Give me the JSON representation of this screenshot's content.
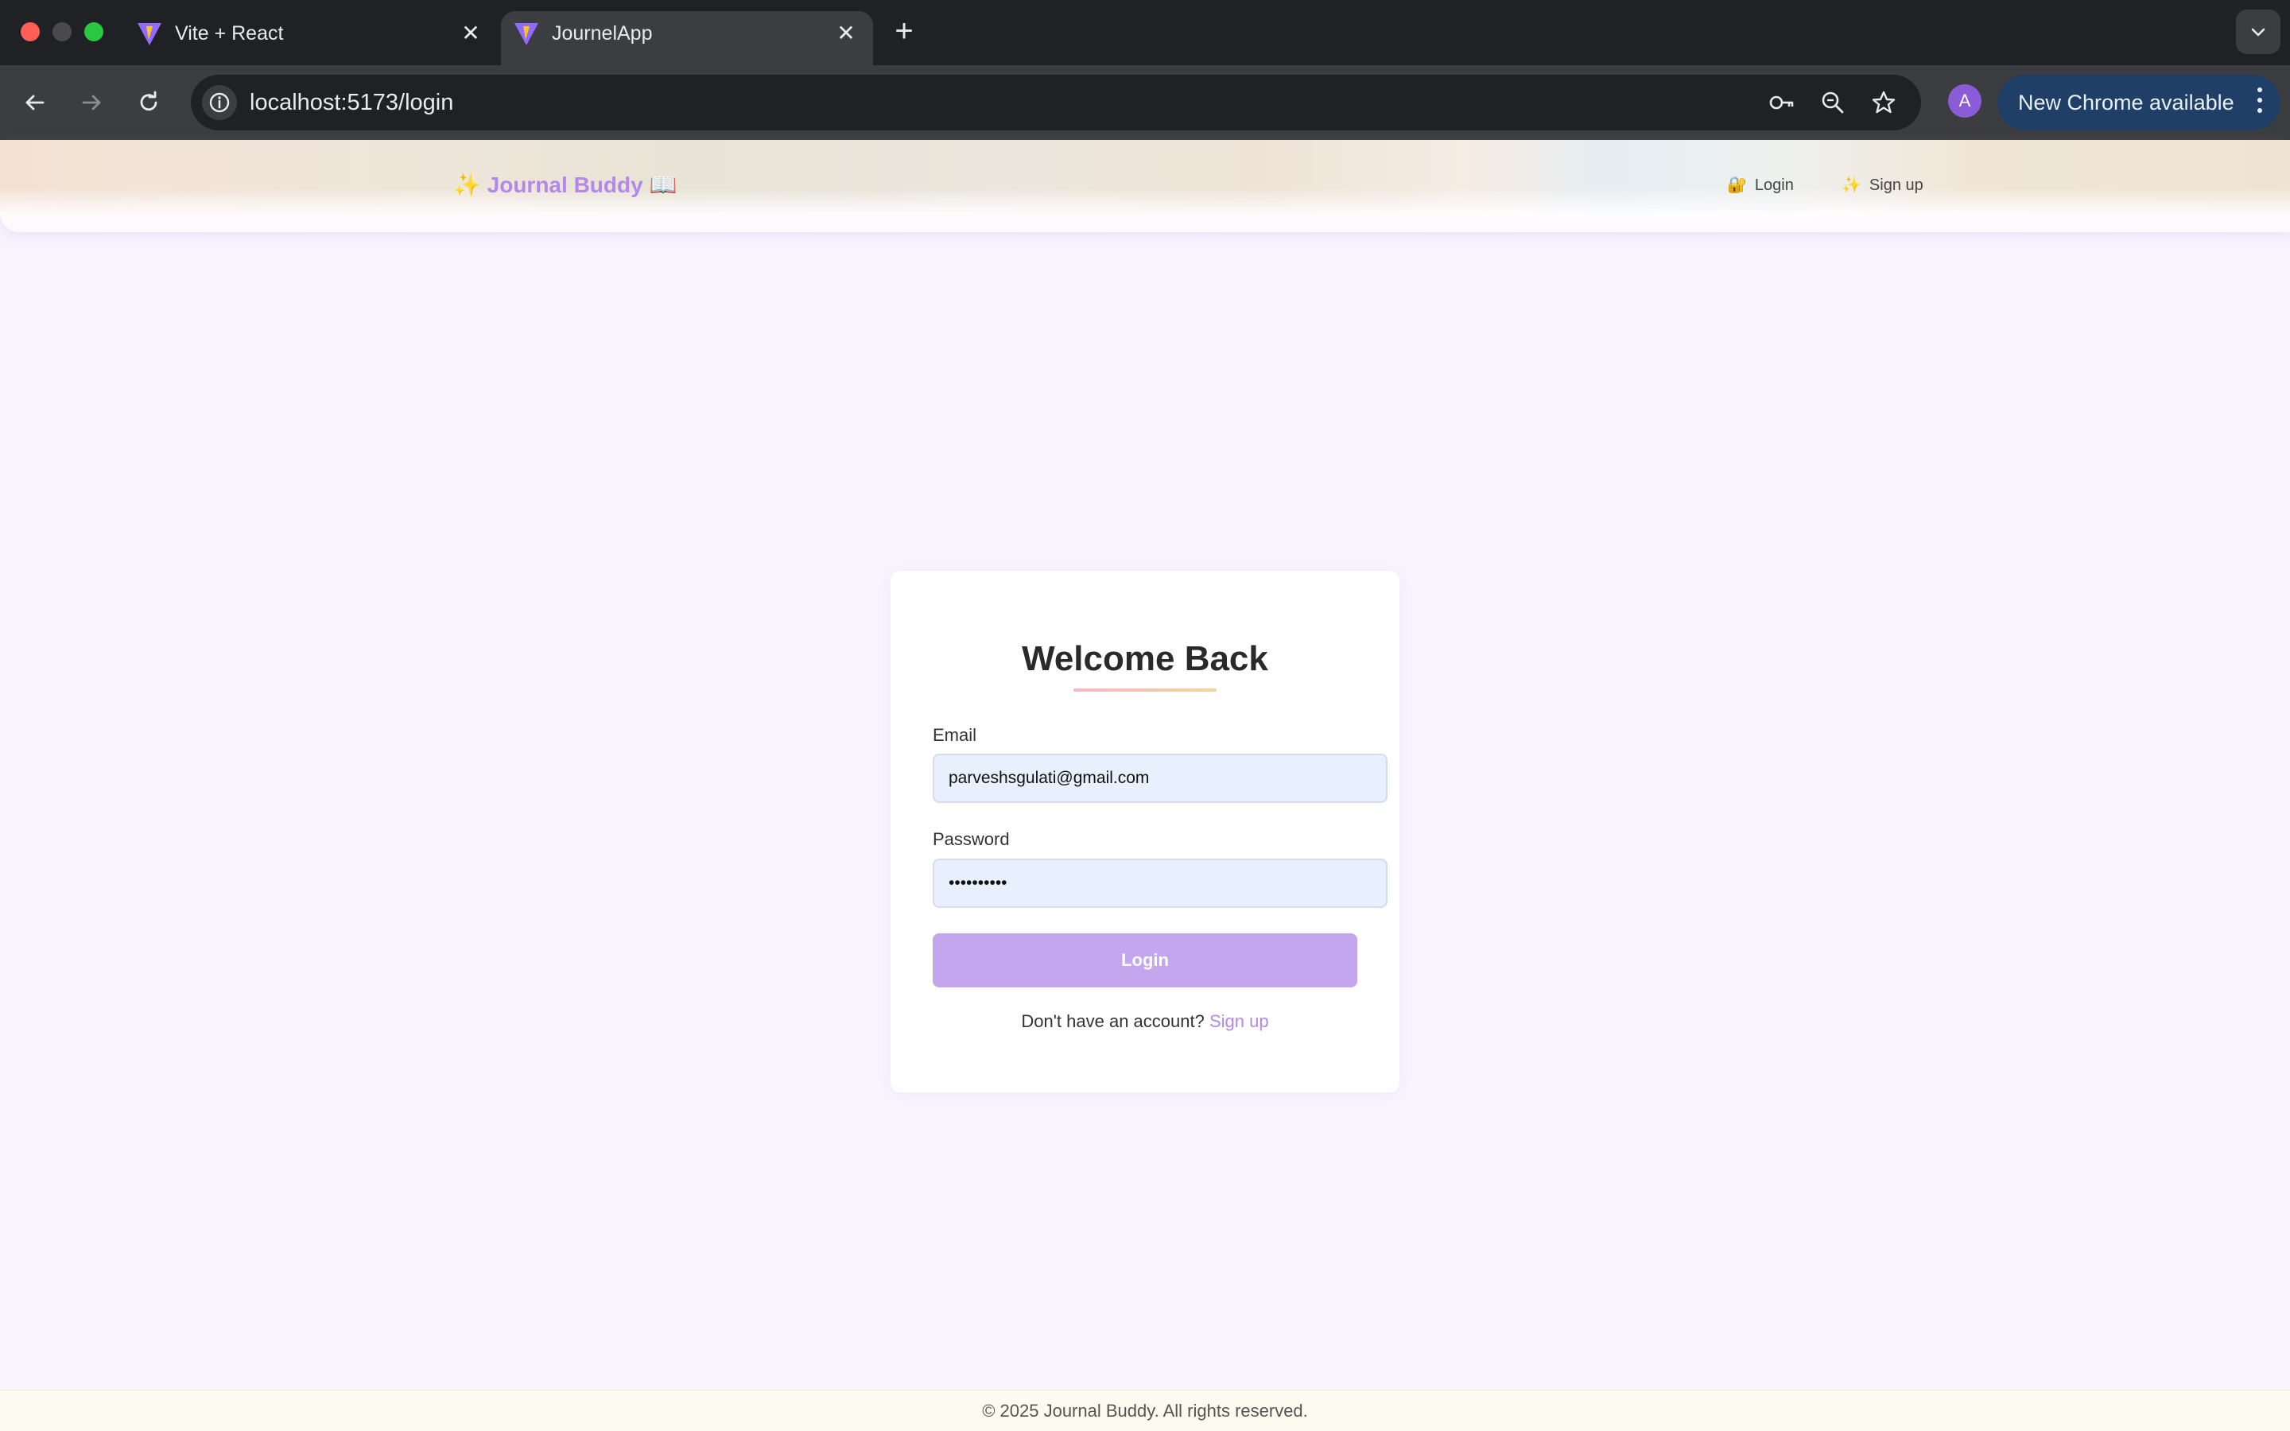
{
  "browser": {
    "tabs": [
      {
        "title": "Vite + React",
        "active": false
      },
      {
        "title": "JournelApp",
        "active": true
      }
    ],
    "url": "localhost:5173/login",
    "profile_initial": "A",
    "update_label": "New Chrome available",
    "icons": [
      "back-icon",
      "forward-icon",
      "reload-icon",
      "site-info-icon",
      "key-icon",
      "zoom-icon",
      "bookmark-star-icon",
      "tab-search-icon",
      "new-tab-icon"
    ]
  },
  "header": {
    "brand": "Journal Buddy",
    "brand_prefix": "✨",
    "brand_suffix": "📖",
    "nav": [
      {
        "emoji": "🔐",
        "label": "Login"
      },
      {
        "emoji": "✨",
        "label": "Sign up"
      }
    ]
  },
  "login_form": {
    "title": "Welcome Back",
    "email_label": "Email",
    "email_value": "parveshsgulati@gmail.com",
    "password_label": "Password",
    "password_value": "••••••••••",
    "submit_label": "Login",
    "signup_prompt": "Don't have an account?",
    "signup_link": "Sign up"
  },
  "footer": {
    "text": "© 2025 Journal Buddy. All rights reserved."
  },
  "colors": {
    "accent": "#b388e8",
    "button": "#c4a6ef",
    "page_bg": "#f7f4fe",
    "input_bg": "#e8f0fe"
  }
}
